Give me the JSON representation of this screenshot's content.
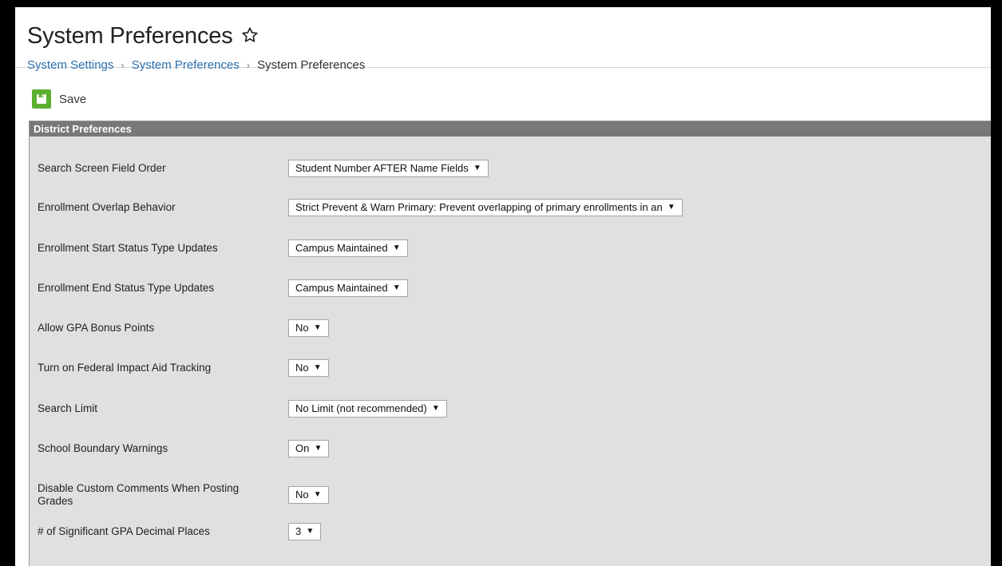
{
  "page": {
    "title": "System Preferences"
  },
  "breadcrumb": [
    {
      "label": "System Settings"
    },
    {
      "label": "System Preferences"
    },
    {
      "label": "System Preferences"
    }
  ],
  "toolbar": {
    "save_label": "Save"
  },
  "panel": {
    "title": "District Preferences"
  },
  "preferences": [
    {
      "label": "Search Screen Field Order",
      "value": "Student Number AFTER Name Fields"
    },
    {
      "label": "Enrollment Overlap Behavior",
      "value": "Strict Prevent & Warn Primary: Prevent overlapping of primary enrollments in an"
    },
    {
      "label": "Enrollment Start Status Type Updates",
      "value": "Campus Maintained"
    },
    {
      "label": "Enrollment End Status Type Updates",
      "value": "Campus Maintained"
    },
    {
      "label": "Allow GPA Bonus Points",
      "value": "No"
    },
    {
      "label": "Turn on Federal Impact Aid Tracking",
      "value": "No"
    },
    {
      "label": "Search Limit",
      "value": "No Limit (not recommended)"
    },
    {
      "label": "School Boundary Warnings",
      "value": "On"
    },
    {
      "label": "Disable Custom Comments When Posting Grades",
      "value": "No"
    },
    {
      "label": "# of Significant GPA Decimal Places",
      "value": "3"
    }
  ],
  "icons": {
    "favorite": "star-outline-icon",
    "save": "floppy-disk-icon",
    "dropdown": "caret-down-icon",
    "breadcrumb_separator": "chevron-right-icon"
  },
  "colors": {
    "link": "#2a6fad",
    "save_green": "#5cb030",
    "panel_header": "#787878",
    "panel_bg": "#e0e0e0"
  },
  "dropdown_caret": "▼",
  "breadcrumb_separator": "›"
}
